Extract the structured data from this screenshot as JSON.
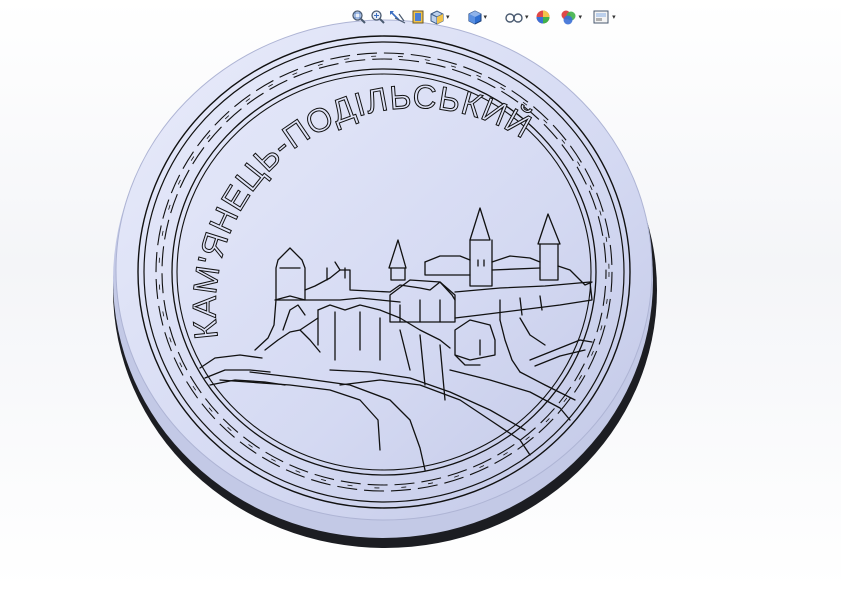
{
  "viewport": {
    "background_top": "#ffffff",
    "background_mid": "#f4f5f8"
  },
  "hud_toolbar": {
    "buttons": [
      {
        "icon": "zoom-to-fit-icon",
        "has_dropdown": false
      },
      {
        "icon": "zoom-to-area-icon",
        "has_dropdown": false
      },
      {
        "icon": "previous-view-icon",
        "has_dropdown": false
      },
      {
        "icon": "section-view-icon",
        "has_dropdown": false
      },
      {
        "icon": "view-orientation-icon",
        "has_dropdown": true
      },
      {
        "icon": "display-style-icon",
        "has_dropdown": true
      },
      {
        "icon": "hide-show-items-icon",
        "has_dropdown": true
      },
      {
        "icon": "edit-appearance-icon",
        "has_dropdown": false
      },
      {
        "icon": "apply-scene-icon",
        "has_dropdown": true
      },
      {
        "icon": "view-settings-icon",
        "has_dropdown": true
      }
    ],
    "dropdown_glyph": "▾"
  },
  "model": {
    "inscription": "КАМ'ЯНЕЦЬ-ПОДІЛЬСЬКИЙ",
    "face_color": "#dfe3f7",
    "edge_color": "#c3c9e6",
    "shadow_color": "#1c1d22",
    "line_color": "#111111"
  }
}
